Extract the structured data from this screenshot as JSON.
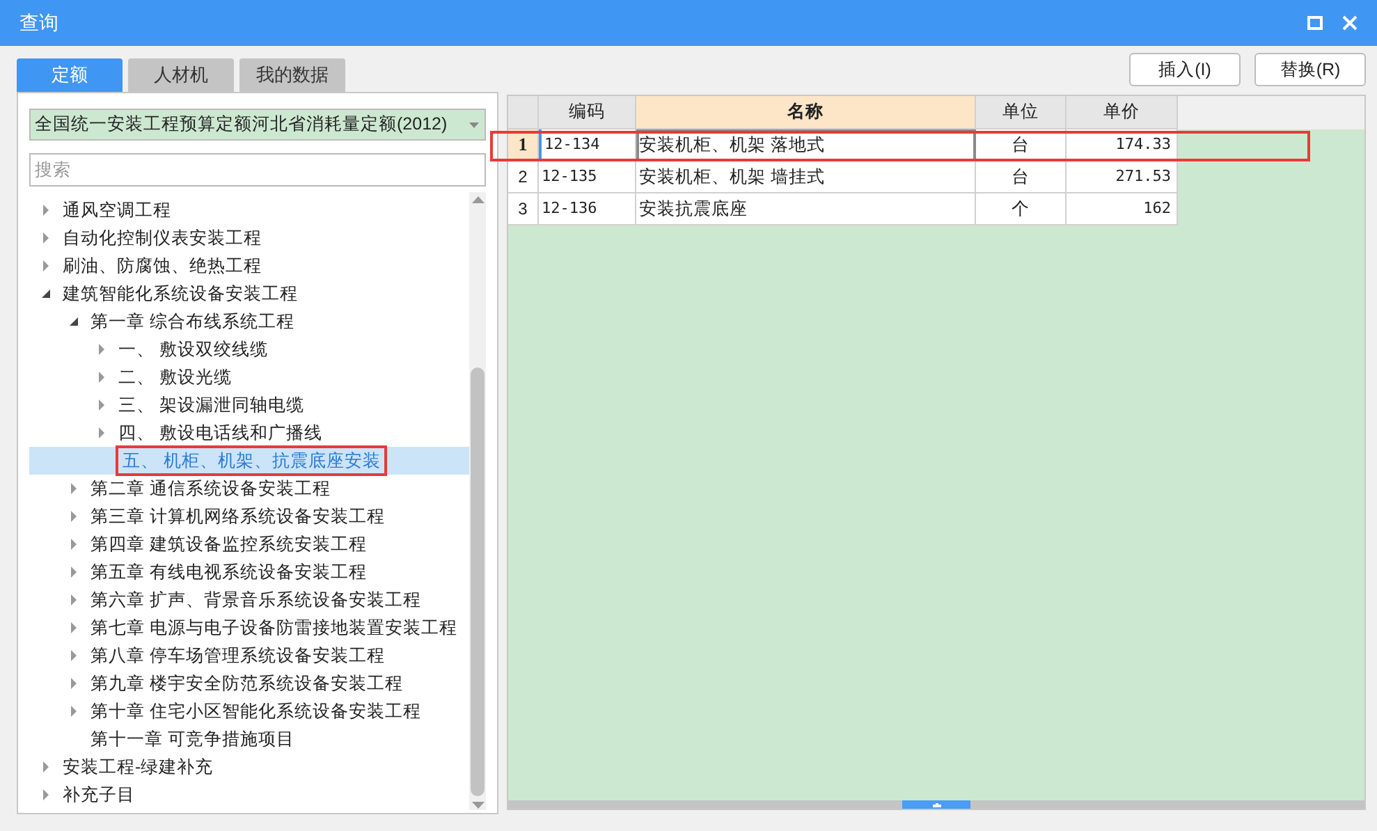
{
  "window": {
    "title": "查询"
  },
  "tabs": [
    {
      "label": "定额",
      "selected": true
    },
    {
      "label": "人材机",
      "selected": false
    },
    {
      "label": "我的数据",
      "selected": false
    }
  ],
  "library_select": {
    "value": "全国统一安装工程预算定额河北省消耗量定额(2012)"
  },
  "search": {
    "placeholder": "搜索"
  },
  "tree": [
    {
      "label": "通风空调工程",
      "kind": "branch",
      "expanded": false,
      "selected": false,
      "highlighted": false
    },
    {
      "label": "自动化控制仪表安装工程",
      "kind": "branch",
      "expanded": false,
      "selected": false,
      "highlighted": false
    },
    {
      "label": "刷油、防腐蚀、绝热工程",
      "kind": "branch",
      "expanded": false,
      "selected": false,
      "highlighted": false
    },
    {
      "label": "建筑智能化系统设备安装工程",
      "kind": "branch",
      "expanded": true,
      "selected": false,
      "highlighted": false,
      "children": [
        {
          "label": "第一章 综合布线系统工程",
          "kind": "branch",
          "expanded": true,
          "selected": false,
          "highlighted": false,
          "children": [
            {
              "label": "一、 敷设双绞线缆",
              "kind": "branch",
              "expanded": false,
              "selected": false,
              "highlighted": false
            },
            {
              "label": "二、 敷设光缆",
              "kind": "branch",
              "expanded": false,
              "selected": false,
              "highlighted": false
            },
            {
              "label": "三、 架设漏泄同轴电缆",
              "kind": "branch",
              "expanded": false,
              "selected": false,
              "highlighted": false
            },
            {
              "label": "四、 敷设电话线和广播线",
              "kind": "branch",
              "expanded": false,
              "selected": false,
              "highlighted": false
            },
            {
              "label": "五、 机柜、机架、抗震底座安装",
              "kind": "leaf",
              "selected": true,
              "highlighted": true
            }
          ]
        },
        {
          "label": "第二章 通信系统设备安装工程",
          "kind": "branch",
          "expanded": false,
          "selected": false,
          "highlighted": false
        },
        {
          "label": "第三章 计算机网络系统设备安装工程",
          "kind": "branch",
          "expanded": false,
          "selected": false,
          "highlighted": false
        },
        {
          "label": "第四章 建筑设备监控系统安装工程",
          "kind": "branch",
          "expanded": false,
          "selected": false,
          "highlighted": false
        },
        {
          "label": "第五章 有线电视系统设备安装工程",
          "kind": "branch",
          "expanded": false,
          "selected": false,
          "highlighted": false
        },
        {
          "label": "第六章 扩声、背景音乐系统设备安装工程",
          "kind": "branch",
          "expanded": false,
          "selected": false,
          "highlighted": false
        },
        {
          "label": "第七章 电源与电子设备防雷接地装置安装工程",
          "kind": "branch",
          "expanded": false,
          "selected": false,
          "highlighted": false
        },
        {
          "label": "第八章 停车场管理系统设备安装工程",
          "kind": "branch",
          "expanded": false,
          "selected": false,
          "highlighted": false
        },
        {
          "label": "第九章 楼宇安全防范系统设备安装工程",
          "kind": "branch",
          "expanded": false,
          "selected": false,
          "highlighted": false
        },
        {
          "label": "第十章 住宅小区智能化系统设备安装工程",
          "kind": "branch",
          "expanded": false,
          "selected": false,
          "highlighted": false
        },
        {
          "label": "第十一章 可竞争措施项目",
          "kind": "leaf",
          "selected": false,
          "highlighted": false
        }
      ]
    },
    {
      "label": "安装工程-绿建补充",
      "kind": "branch",
      "expanded": false,
      "selected": false,
      "highlighted": false
    },
    {
      "label": "补充子目",
      "kind": "branch",
      "expanded": false,
      "selected": false,
      "highlighted": false
    }
  ],
  "buttons": [
    {
      "label": "插入(I)"
    },
    {
      "label": "替换(R)"
    }
  ],
  "table": {
    "columns": [
      {
        "label": "编码",
        "selected": false
      },
      {
        "label": "名称",
        "selected": true
      },
      {
        "label": "单位",
        "selected": false
      },
      {
        "label": "单价",
        "selected": false
      }
    ],
    "rows": [
      {
        "number": "1",
        "cells": [
          "12-134",
          "安装机柜、机架 落地式",
          "台",
          "174.33"
        ],
        "selected": true,
        "highlighted": true
      },
      {
        "number": "2",
        "cells": [
          "12-135",
          "安装机柜、机架 墙挂式",
          "台",
          "271.53"
        ],
        "selected": false,
        "highlighted": false
      },
      {
        "number": "3",
        "cells": [
          "12-136",
          "安装抗震底座",
          "个",
          "162"
        ],
        "selected": false,
        "highlighted": false
      }
    ]
  }
}
